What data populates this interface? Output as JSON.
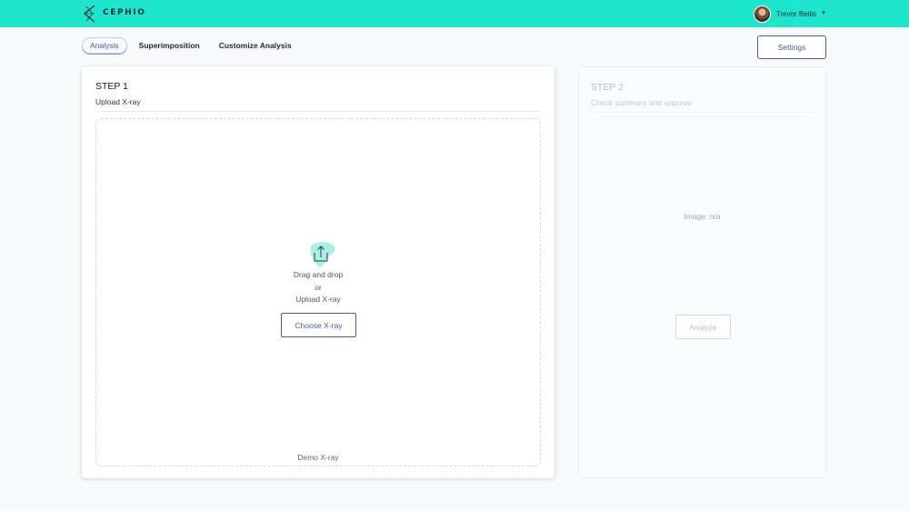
{
  "header": {
    "logo_text": "CEPHIO",
    "user_name": "Trevor Beilis",
    "brand_color": "#1de6cd"
  },
  "tabs": [
    {
      "label": "Analysis",
      "active": true
    },
    {
      "label": "Superimposition",
      "active": false
    },
    {
      "label": "Customize Analysis",
      "active": false
    }
  ],
  "settings_label": "Settings",
  "step1": {
    "title": "STEP 1",
    "subtitle": "Upload X-ray",
    "icon": "upload-icon",
    "drag_text": "Drag and drop",
    "or_text": "or",
    "upload_text": "Upload X-ray",
    "choose_label": "Choose X-ray",
    "demo_label": "Demo X-ray"
  },
  "step2": {
    "title": "STEP 2",
    "subtitle": "Check summary and approve",
    "image_text": "Image: n/a",
    "analyze_label": "Analyze"
  },
  "accent_color": "#4c5a9b"
}
